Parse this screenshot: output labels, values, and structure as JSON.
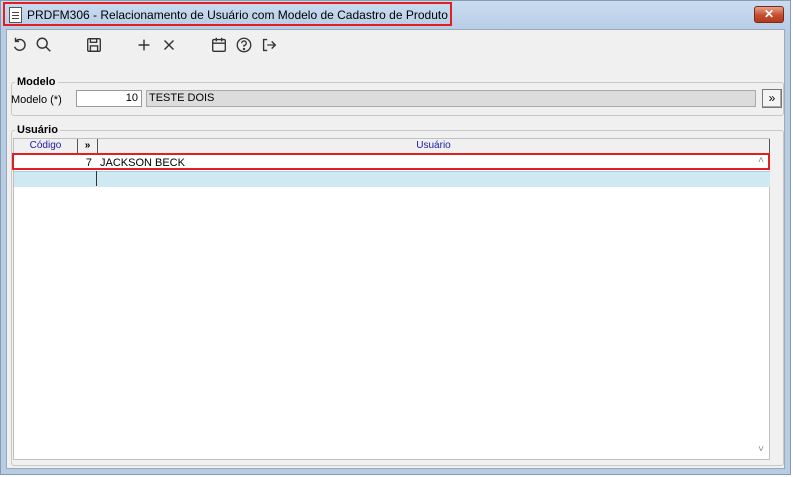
{
  "window": {
    "title": "PRDFM306 - Relacionamento de Usuário com Modelo de Cadastro de Produto",
    "close_label": "✕"
  },
  "toolbar": {
    "icons": [
      "undo-icon",
      "search-icon",
      "save-icon",
      "add-icon",
      "delete-icon",
      "calendar-icon",
      "help-icon",
      "exit-icon"
    ]
  },
  "modelo": {
    "group_label": "Modelo",
    "field_label": "Modelo (*)",
    "code_value": "10",
    "description_value": "TESTE DOIS",
    "lookup_label": "»"
  },
  "usuario": {
    "group_label": "Usuário",
    "columns": [
      "Código",
      "»",
      "Usuário"
    ],
    "rows": [
      {
        "codigo": "7",
        "usuario": "JACKSON BECK"
      },
      {
        "codigo": "",
        "usuario": ""
      }
    ]
  },
  "colors": {
    "highlight": "#e02020",
    "title_bar": "#c9dcf0",
    "selected_row": "#cfe9f3",
    "header_text": "#1a1aa6"
  }
}
